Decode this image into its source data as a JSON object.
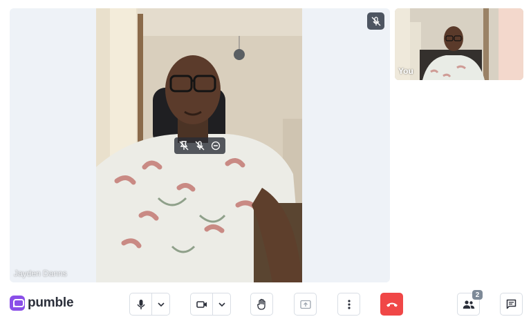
{
  "app": {
    "brand_name": "pumble",
    "brand_color": "#8a4fe8"
  },
  "call": {
    "main_participant": {
      "name": "Jayden Danns",
      "muted": true
    },
    "self_participant": {
      "name": "You"
    },
    "participants_count": "2"
  },
  "toolbar": {
    "icons": {
      "mic": "microphone-icon",
      "camera": "video-camera-icon",
      "raise_hand": "hand-icon",
      "share_screen": "screen-share-icon",
      "more": "more-options-icon",
      "end_call": "hang-up-icon",
      "participants": "participants-icon",
      "chat": "chat-icon"
    },
    "end_call_color": "#f04747"
  }
}
